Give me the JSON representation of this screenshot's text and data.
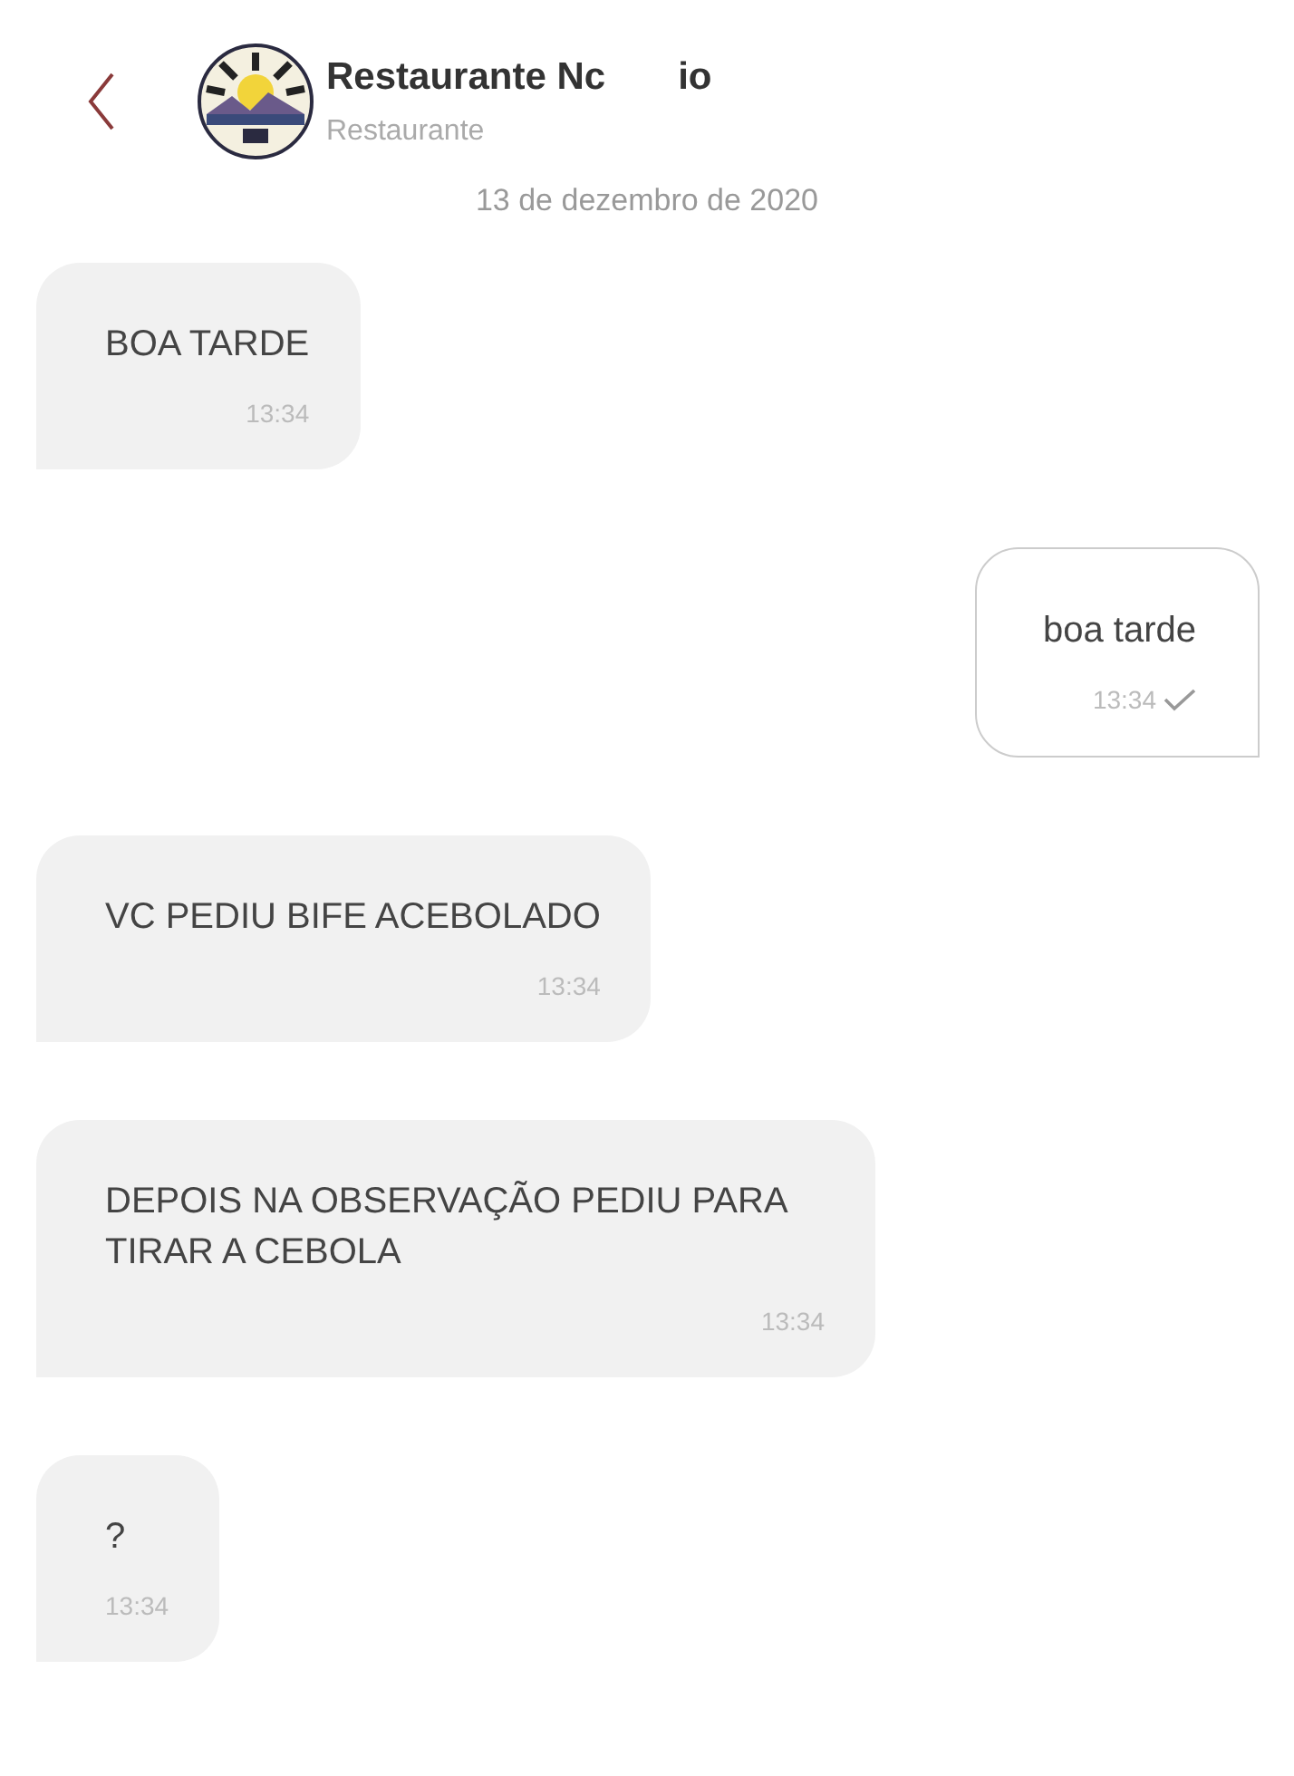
{
  "header": {
    "title_parts": [
      "Restaurante Nc",
      "io"
    ],
    "subtitle": "Restaurante"
  },
  "date": "13 de dezembro de 2020",
  "messages": [
    {
      "kind": "incoming",
      "text": "BOA TARDE",
      "time": "13:34"
    },
    {
      "kind": "outgoing",
      "text": "boa tarde",
      "time": "13:34",
      "delivered": true
    },
    {
      "kind": "incoming",
      "text": "VC PEDIU BIFE ACEBOLADO",
      "time": "13:34"
    },
    {
      "kind": "incoming",
      "text": "DEPOIS NA OBSERVAÇÃO PEDIU PARA TIRAR A CEBOLA",
      "time": "13:34"
    },
    {
      "kind": "incoming",
      "text": "?",
      "time": "13:34"
    }
  ]
}
